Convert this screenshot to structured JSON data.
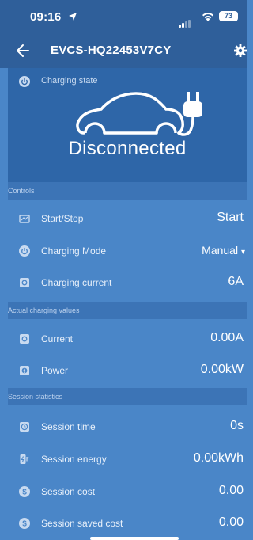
{
  "status_bar": {
    "time": "09:16",
    "battery": "73"
  },
  "header": {
    "title": "EVCS-HQ22453V7CY"
  },
  "charging_state": {
    "label": "Charging state",
    "status": "Disconnected"
  },
  "sections": {
    "controls": "Controls",
    "actual": "Actual charging values",
    "session": "Session statistics"
  },
  "controls": {
    "start_stop": {
      "label": "Start/Stop",
      "value": "Start"
    },
    "mode": {
      "label": "Charging Mode",
      "value": "Manual"
    },
    "current": {
      "label": "Charging current",
      "value": "6A"
    }
  },
  "actual": {
    "current": {
      "label": "Current",
      "value": "0.00A"
    },
    "power": {
      "label": "Power",
      "value": "0.00kW"
    }
  },
  "session": {
    "time": {
      "label": "Session time",
      "value": "0s"
    },
    "energy": {
      "label": "Session energy",
      "value": "0.00kWh"
    },
    "cost": {
      "label": "Session cost",
      "value": "0.00"
    },
    "saved": {
      "label": "Session saved cost",
      "value": "0.00"
    }
  },
  "colors": {
    "header": "#2f5f9a",
    "background": "#4a86c8",
    "hero": "#2e66a8",
    "section": "#3c74b6"
  }
}
